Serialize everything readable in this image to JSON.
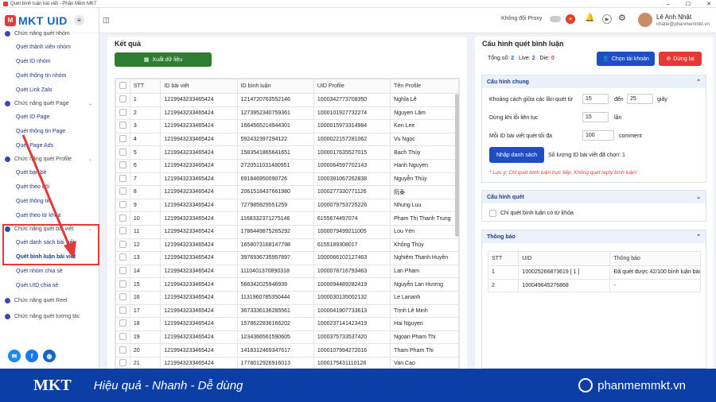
{
  "window": {
    "title": "Quét bình luận bài viết - Phần Mềm MKT",
    "controls": [
      "–",
      "☐",
      "✕"
    ]
  },
  "brand": {
    "logo_mark": "M",
    "logo_text": "MKT UID"
  },
  "topbar": {
    "proxy_label": "Không đổi Proxy",
    "user_name": "Lê Anh Nhật",
    "user_email": "nhatle@phanmemmkt.vn"
  },
  "sidebar": {
    "groups": [
      {
        "label": "Chức năng quét nhóm",
        "items": [
          "Quét thành viên nhóm",
          "Quét ID nhóm",
          "Quét thông tin nhóm",
          "Quét Link Zalo"
        ]
      },
      {
        "label": "Chức năng quét Page",
        "items": [
          "Quét ID Page",
          "Quét thông tin Page",
          "Quét Page Ads"
        ]
      },
      {
        "label": "Chức năng quét Profile",
        "items": [
          "Quét bạn bè",
          "Quét theo dõi",
          "Quét thông tin",
          "Quét theo từ khóa"
        ]
      },
      {
        "label": "Chức năng quét bài viết",
        "items": [
          "Quét danh sách bài viết",
          "Quét bình luận bài viết",
          "Quét nhóm chia sẻ",
          "Quét UID chia sẻ"
        ]
      },
      {
        "label": "Chức năng quét Reel",
        "items": []
      },
      {
        "label": "Chức năng quét tương tác",
        "items": []
      }
    ]
  },
  "results": {
    "title": "Kết quả",
    "export_label": "Xuất dữ liệu",
    "columns": [
      "STT",
      "ID bài viết",
      "ID bình luận",
      "UID Profile",
      "Tên Profile"
    ],
    "rows": [
      [
        "1",
        "1219943233465424",
        "1214720763552146",
        "1000342773708350",
        "Nghĩa Lê"
      ],
      [
        "2",
        "1219943233465424",
        "1273952340759361",
        "1000101927732274",
        "Nguyen Lâm"
      ],
      [
        "3",
        "1219943233465424",
        "1664565214944301",
        "1000015973314984",
        "Ken Lee"
      ],
      [
        "4",
        "1219943233465424",
        "592432397294122",
        "1000022157281062",
        "Vu Ngọc"
      ],
      [
        "5",
        "1219943233465424",
        "1583541865641651",
        "1000017635527015",
        "Bạch Thúy"
      ],
      [
        "6",
        "1219943233465424",
        "2720511031480951",
        "1000064597702143",
        "Hanh Nguyen"
      ],
      [
        "7",
        "1219943233465424",
        "691846950090726",
        "1000381067262838",
        "Nguyễn Thủy"
      ],
      [
        "8",
        "1219943233465424",
        "2061518437661980",
        "1000277330771126",
        "阮泰"
      ],
      [
        "9",
        "1219943233465424",
        "727985929551259",
        "1000079753725226",
        "Nhung Luu"
      ],
      [
        "10",
        "1219943233465424",
        "1168332371275146",
        "6155674497074",
        "Phạm Thị Thanh Trung"
      ],
      [
        "11",
        "1219943233465424",
        "1786449875265292",
        "1000079499211005",
        "Lou Yén"
      ],
      [
        "12",
        "1219943233465424",
        "1658073168147798",
        "6155189308017",
        "Khống Thủy"
      ],
      [
        "13",
        "1219943233465424",
        "3976936735957897",
        "1000066102127463",
        "Nghiêm Thanh Huyền"
      ],
      [
        "14",
        "1219943233465424",
        "1110401370890318",
        "1000078716793463",
        "Lan Pham"
      ],
      [
        "15",
        "1219943233465424",
        "566342025946939",
        "1000094489282419",
        "Nguyễn Lan Hương"
      ],
      [
        "16",
        "1219943233465424",
        "1131960785350444",
        "1000030135002132",
        "Le Lananh"
      ],
      [
        "17",
        "1219943233465424",
        "3673336136285561",
        "1000041907733613",
        "Trịnh Lê Minh"
      ],
      [
        "18",
        "1219943233465424",
        "1578622836166202",
        "1000237141423419",
        "Hai Nguyen"
      ],
      [
        "19",
        "1219943233465424",
        "1234366561590605",
        "1000375733537420",
        "Ngoan Pham Thi"
      ],
      [
        "20",
        "1219943233465424",
        "1418312469347617",
        "1000107994272016",
        "Tham Pham Thi"
      ],
      [
        "21",
        "1219943233465424",
        "1778012926916013",
        "1000175431110128",
        "Van Cao"
      ]
    ]
  },
  "config": {
    "title": "Cấu hình quét bình luận",
    "stats": {
      "total_label": "Tổng số:",
      "total": "2",
      "live_label": "Live:",
      "live": "2",
      "die_label": "Die:",
      "die": "0"
    },
    "choose_label": "Chọn tài khoản",
    "stop_label": "Dừng lại",
    "general": {
      "title": "Cấu hình chung",
      "delay_label": "Khoảng cách giữa các lần quét từ",
      "delay_from": "15",
      "to_label": "đến",
      "delay_to": "25",
      "sec_label": "giây",
      "stop_error_label": "Dừng khi lỗi liên tục",
      "stop_error": "15",
      "times_label": "lần",
      "max_label": "Mỗi ID bài viết quét tối đa",
      "max_value": "100",
      "comment_label": "comment",
      "import_label": "Nhập danh sách",
      "count_label": "Số lượng ID bài viết đã chọn: 1",
      "note": "* Lưu ý: Chỉ quét bình luận trực tiếp, Không quét reply bình luận!"
    },
    "scan": {
      "title": "Cấu hình quét",
      "keyword_label": "Chỉ quét bình luận có từ khóa"
    },
    "log": {
      "title": "Thông báo",
      "columns": [
        "STT",
        "UID",
        "Thông báo"
      ],
      "rows": [
        [
          "1",
          "100025266873619 [ 1 ]",
          "Đã quét được 42/100 bình luận bài"
        ],
        [
          "2",
          "100049645276868",
          "-"
        ]
      ]
    }
  },
  "footer": {
    "logo": "MKT",
    "slogan": "Hiệu quả - Nhanh - Dễ dùng",
    "site": "phanmemmkt.vn"
  },
  "colors": {
    "primary": "#0b3fa6",
    "accent_green": "#2e7d32",
    "accent_red": "#e53935",
    "link": "#1e3a8a"
  }
}
